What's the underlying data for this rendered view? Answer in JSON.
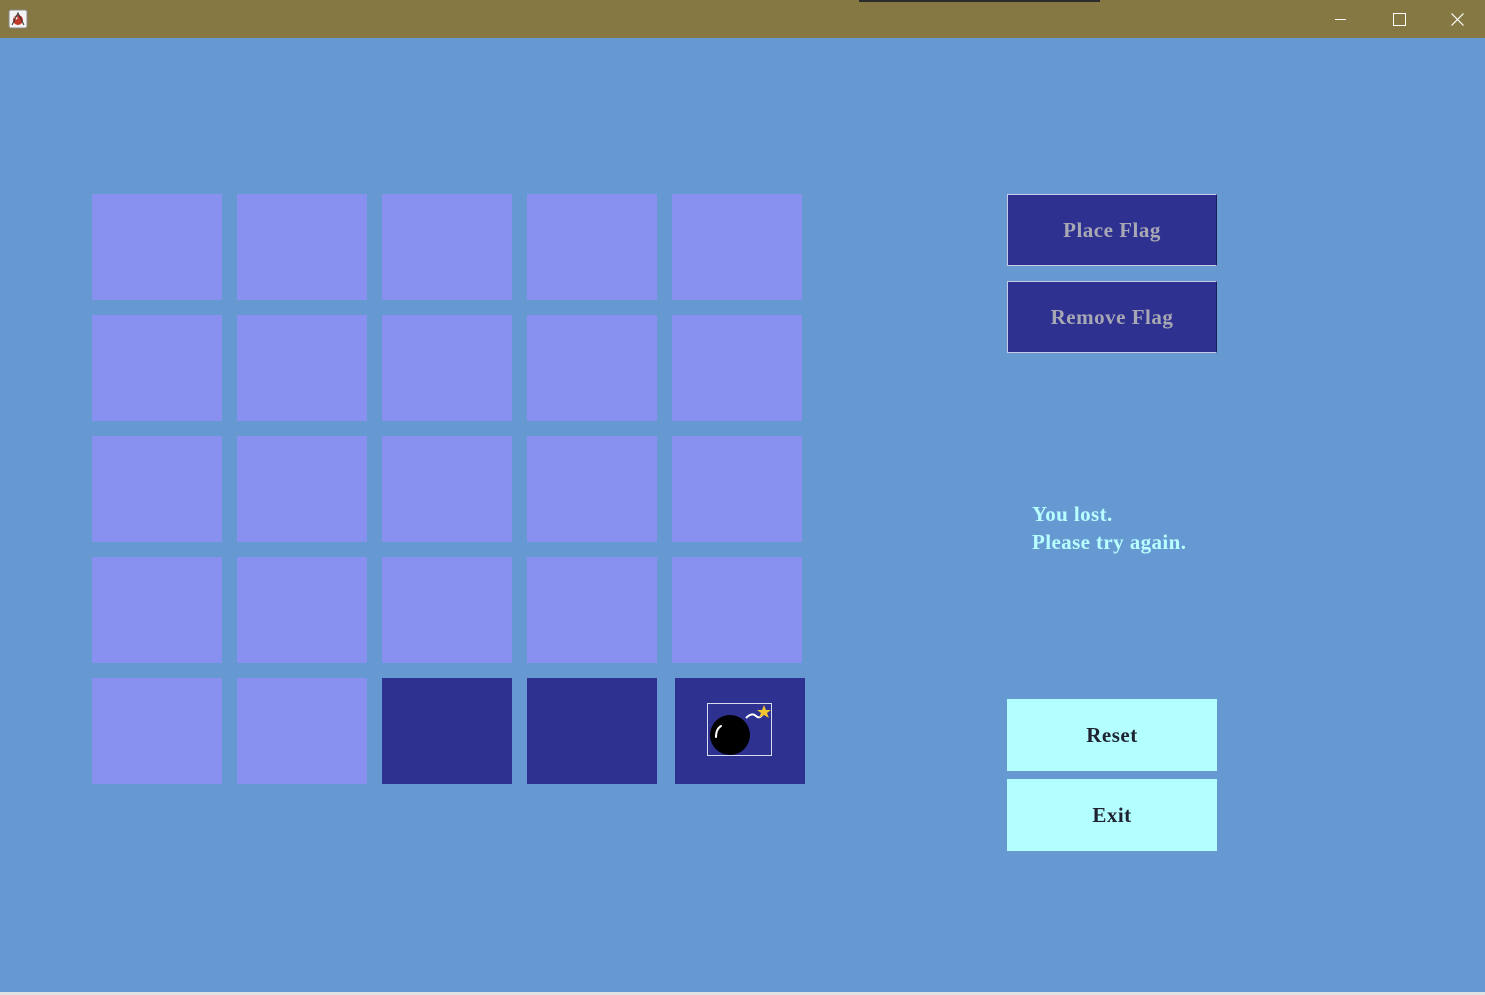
{
  "window": {
    "app_icon": "minesweeper-app-icon",
    "controls": {
      "minimize_glyph": "─",
      "maximize_glyph": "☐",
      "close_glyph": "✕"
    }
  },
  "board": {
    "rows": 5,
    "cols": 5,
    "cells": [
      [
        "hidden",
        "hidden",
        "hidden",
        "hidden",
        "hidden"
      ],
      [
        "hidden",
        "hidden",
        "hidden",
        "hidden",
        "hidden"
      ],
      [
        "hidden",
        "hidden",
        "hidden",
        "hidden",
        "hidden"
      ],
      [
        "hidden",
        "hidden",
        "hidden",
        "hidden",
        "hidden"
      ],
      [
        "hidden",
        "hidden",
        "revealed",
        "revealed",
        "bomb"
      ]
    ],
    "colors": {
      "hidden": "#8890f0",
      "revealed": "#2e3190"
    }
  },
  "controls": {
    "place_flag_label": "Place Flag",
    "remove_flag_label": "Remove Flag",
    "reset_label": "Reset",
    "exit_label": "Exit"
  },
  "status": {
    "line1": "You lost.",
    "line2": "Please try again."
  },
  "colors": {
    "background": "#6699d2",
    "titlebar": "#857843",
    "flag_button": "#2e3190",
    "action_button": "#b3ffff",
    "status_text": "#b8ffff"
  }
}
